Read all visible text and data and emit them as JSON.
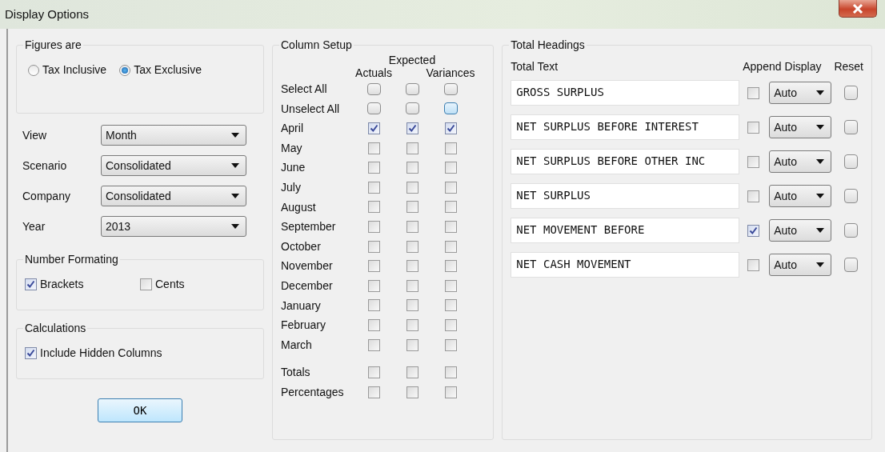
{
  "window": {
    "title": "Display Options"
  },
  "figures_are": {
    "title": "Figures are",
    "options": [
      {
        "label": "Tax Inclusive",
        "selected": false
      },
      {
        "label": "Tax Exclusive",
        "selected": true
      }
    ]
  },
  "selectors": [
    {
      "label": "View",
      "value": "Month"
    },
    {
      "label": "Scenario",
      "value": "Consolidated"
    },
    {
      "label": "Company",
      "value": "Consolidated"
    },
    {
      "label": "Year",
      "value": "2013"
    }
  ],
  "number_formatting": {
    "title": "Number Formating",
    "options": [
      {
        "label": "Brackets",
        "checked": true
      },
      {
        "label": "Cents",
        "checked": false
      }
    ]
  },
  "calculations": {
    "title": "Calculations",
    "options": [
      {
        "label": "Include Hidden Columns",
        "checked": true
      }
    ]
  },
  "ok_button": "OK",
  "column_setup": {
    "title": "Column Setup",
    "columns": [
      "Actuals",
      "Expected",
      "Variances"
    ],
    "action_rows": [
      {
        "label": "Select All",
        "buttons": [
          {
            "hovered": false
          },
          {
            "hovered": false
          },
          {
            "hovered": false
          }
        ]
      },
      {
        "label": "Unselect All",
        "buttons": [
          {
            "hovered": false
          },
          {
            "hovered": false
          },
          {
            "hovered": true
          }
        ]
      }
    ],
    "month_rows": [
      {
        "label": "April",
        "checked": [
          true,
          true,
          true
        ]
      },
      {
        "label": "May",
        "checked": [
          false,
          false,
          false
        ]
      },
      {
        "label": "June",
        "checked": [
          false,
          false,
          false
        ]
      },
      {
        "label": "July",
        "checked": [
          false,
          false,
          false
        ]
      },
      {
        "label": "August",
        "checked": [
          false,
          false,
          false
        ]
      },
      {
        "label": "September",
        "checked": [
          false,
          false,
          false
        ]
      },
      {
        "label": "October",
        "checked": [
          false,
          false,
          false
        ]
      },
      {
        "label": "November",
        "checked": [
          false,
          false,
          false
        ]
      },
      {
        "label": "December",
        "checked": [
          false,
          false,
          false
        ]
      },
      {
        "label": "January",
        "checked": [
          false,
          false,
          false
        ]
      },
      {
        "label": "February",
        "checked": [
          false,
          false,
          false
        ]
      },
      {
        "label": "March",
        "checked": [
          false,
          false,
          false
        ]
      }
    ],
    "summary_rows": [
      {
        "label": "Totals",
        "checked": [
          false,
          false,
          false
        ]
      },
      {
        "label": "Percentages",
        "checked": [
          false,
          false,
          false
        ]
      }
    ]
  },
  "total_headings": {
    "title": "Total Headings",
    "columns": [
      "Total Text",
      "Append",
      "Display",
      "Reset"
    ],
    "rows": [
      {
        "text": "GROSS SURPLUS",
        "append": false,
        "display": "Auto"
      },
      {
        "text": "NET SURPLUS BEFORE INTEREST",
        "append": false,
        "display": "Auto"
      },
      {
        "text": "NET SURPLUS BEFORE OTHER INC",
        "append": false,
        "display": "Auto"
      },
      {
        "text": "NET SURPLUS",
        "append": false,
        "display": "Auto"
      },
      {
        "text": "NET MOVEMENT BEFORE",
        "append": true,
        "display": "Auto"
      },
      {
        "text": "NET CASH MOVEMENT",
        "append": false,
        "display": "Auto"
      }
    ]
  }
}
